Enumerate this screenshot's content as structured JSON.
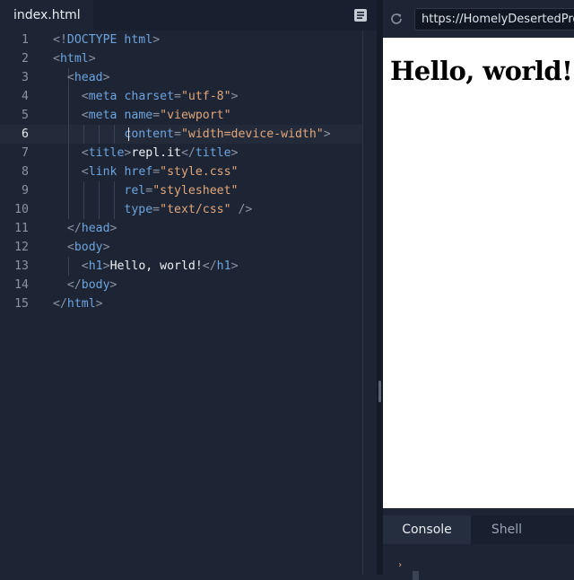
{
  "editor": {
    "active_file": "index.html",
    "active_line": 6,
    "lines": [
      {
        "n": "1",
        "tokens": [
          [
            "punc",
            "<!"
          ],
          [
            "tag",
            "DOCTYPE"
          ],
          [
            "text",
            " "
          ],
          [
            "attr",
            "html"
          ],
          [
            "punc",
            ">"
          ]
        ]
      },
      {
        "n": "2",
        "tokens": [
          [
            "punc",
            "<"
          ],
          [
            "tag",
            "html"
          ],
          [
            "punc",
            ">"
          ]
        ]
      },
      {
        "n": "3",
        "tokens": [
          [
            "text",
            "  "
          ],
          [
            "punc",
            "<"
          ],
          [
            "tag",
            "head"
          ],
          [
            "punc",
            ">"
          ]
        ]
      },
      {
        "n": "4",
        "tokens": [
          [
            "text",
            "    "
          ],
          [
            "punc",
            "<"
          ],
          [
            "tag",
            "meta"
          ],
          [
            "text",
            " "
          ],
          [
            "attr",
            "charset"
          ],
          [
            "punc",
            "="
          ],
          [
            "str",
            "\"utf-8\""
          ],
          [
            "punc",
            ">"
          ]
        ]
      },
      {
        "n": "5",
        "tokens": [
          [
            "text",
            "    "
          ],
          [
            "punc",
            "<"
          ],
          [
            "tag",
            "meta"
          ],
          [
            "text",
            " "
          ],
          [
            "attr",
            "name"
          ],
          [
            "punc",
            "="
          ],
          [
            "str",
            "\"viewport\""
          ]
        ]
      },
      {
        "n": "6",
        "tokens": [
          [
            "text",
            "          "
          ],
          [
            "attr",
            "content"
          ],
          [
            "punc",
            "="
          ],
          [
            "str",
            "\"width=device-width\""
          ],
          [
            "punc",
            ">"
          ]
        ]
      },
      {
        "n": "7",
        "tokens": [
          [
            "text",
            "    "
          ],
          [
            "punc",
            "<"
          ],
          [
            "tag",
            "title"
          ],
          [
            "punc",
            ">"
          ],
          [
            "text",
            "repl.it"
          ],
          [
            "punc",
            "</"
          ],
          [
            "tag",
            "title"
          ],
          [
            "punc",
            ">"
          ]
        ]
      },
      {
        "n": "8",
        "tokens": [
          [
            "text",
            "    "
          ],
          [
            "punc",
            "<"
          ],
          [
            "tag",
            "link"
          ],
          [
            "text",
            " "
          ],
          [
            "attr",
            "href"
          ],
          [
            "punc",
            "="
          ],
          [
            "str",
            "\"style.css\""
          ]
        ]
      },
      {
        "n": "9",
        "tokens": [
          [
            "text",
            "          "
          ],
          [
            "attr",
            "rel"
          ],
          [
            "punc",
            "="
          ],
          [
            "str",
            "\"stylesheet\""
          ]
        ]
      },
      {
        "n": "10",
        "tokens": [
          [
            "text",
            "          "
          ],
          [
            "attr",
            "type"
          ],
          [
            "punc",
            "="
          ],
          [
            "str",
            "\"text/css\""
          ],
          [
            "text",
            " "
          ],
          [
            "punc",
            "/>"
          ]
        ]
      },
      {
        "n": "11",
        "tokens": [
          [
            "text",
            "  "
          ],
          [
            "punc",
            "</"
          ],
          [
            "tag",
            "head"
          ],
          [
            "punc",
            ">"
          ]
        ]
      },
      {
        "n": "12",
        "tokens": [
          [
            "text",
            "  "
          ],
          [
            "punc",
            "<"
          ],
          [
            "tag",
            "body"
          ],
          [
            "punc",
            ">"
          ]
        ]
      },
      {
        "n": "13",
        "tokens": [
          [
            "text",
            "    "
          ],
          [
            "punc",
            "<"
          ],
          [
            "tag",
            "h1"
          ],
          [
            "punc",
            ">"
          ],
          [
            "text",
            "Hello, world!"
          ],
          [
            "punc",
            "</"
          ],
          [
            "tag",
            "h1"
          ],
          [
            "punc",
            ">"
          ]
        ]
      },
      {
        "n": "14",
        "tokens": [
          [
            "text",
            "  "
          ],
          [
            "punc",
            "</"
          ],
          [
            "tag",
            "body"
          ],
          [
            "punc",
            ">"
          ]
        ]
      },
      {
        "n": "15",
        "tokens": [
          [
            "punc",
            "</"
          ],
          [
            "tag",
            "html"
          ],
          [
            "punc",
            ">"
          ]
        ]
      }
    ]
  },
  "browser": {
    "url": "https://HomelyDesertedProce",
    "page_heading": "Hello, world!"
  },
  "console": {
    "tabs": [
      "Console",
      "Shell"
    ],
    "active_tab": "Console",
    "prompt_glyph": "›"
  },
  "colors": {
    "bg": "#1d2433",
    "tag": "#6fa4de",
    "string": "#e0a77c",
    "punctuation": "#8a93a3"
  },
  "icons": [
    "files-icon",
    "refresh-icon",
    "prompt-icon"
  ]
}
